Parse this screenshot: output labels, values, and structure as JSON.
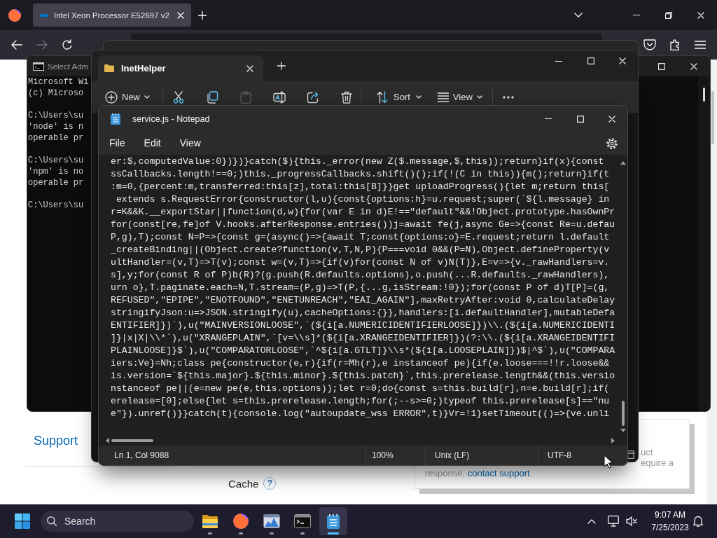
{
  "browser": {
    "tab": {
      "title": "Intel Xeon Processor E52697 v2",
      "selected": true
    },
    "nav_buttons": [
      {
        "disabled": false
      },
      {
        "disabled": true
      },
      {
        "disabled": false
      }
    ]
  },
  "web_page": {
    "sidebar_link": "Support",
    "field": {
      "label": "Cache",
      "help": "?"
    },
    "notice": {
      "lines": [
        "uct",
        "equire a"
      ],
      "text": "response,",
      "link": "contact support",
      "end": "."
    }
  },
  "command_prompt": {
    "title": "Select Adm",
    "blocks": [
      [
        "Microsoft Wi",
        "(c) Microso"
      ],
      [
        "C:\\Users\\su",
        "'node' is n",
        "operable pr"
      ],
      [
        "C:\\Users\\su",
        "'npm' is no",
        "operable pr"
      ],
      [
        "C:\\Users\\su"
      ]
    ]
  },
  "file_explorer": {
    "tab": "InetHelper",
    "toolbar": {
      "new": "New",
      "sort": "Sort",
      "view": "View",
      "actions": [
        {
          "disabled": false
        },
        {
          "disabled": false
        },
        {
          "disabled": true
        },
        {
          "disabled": false
        },
        {
          "disabled": false
        },
        {
          "disabled": false
        }
      ]
    }
  },
  "notepad": {
    "title": "service.js - Notepad",
    "menu": [
      "File",
      "Edit",
      "View"
    ],
    "lines": [
      "er:$,computedValue:0})})}catch($){this._error(new Z($.message,$,this));return}if(x){const",
      "ssCallbacks.length!==0;)this._progressCallbacks.shift()();if(!(C in this)){m();return}if(t",
      ":m=0,{percent:m,transferred:this[z],total:this[B]}}get uploadProgress(){let m;return this[",
      " extends s.RequestError{constructor(l,u){const{options:h}=u.request;super(`${l.message} in",
      "r=K&&K.__exportStar||function(d,w){for(var E in d)E!==\"default\"&&!Object.prototype.hasOwnPr",
      "for(const[re,fe]of V.hooks.afterResponse.entries())j=await fe(j,async Ge=>{const Re=u.defau",
      "P,g),T);const N=P=>{const g=(async()=>{await T;const{options:o}=E.request;return l.default",
      "_createBinding||(Object.create?function(v,T,N,P){P===void 0&&(P=N),Object.defineProperty(v",
      "ultHandler=(v,T)=>T(v);const w=(v,T)=>{if(v)for(const N of v)N(T)},E=v=>{v._rawHandlers=v.",
      "s],y;for(const R of P)b(R)?(g.push(R.defaults.options),o.push(...R.defaults._rawHandlers),",
      "urn o},T.paginate.each=N,T.stream=(P,g)=>T(P,{...g,isStream:!0});for(const P of d)T[P]=(g,",
      "REFUSED\",\"EPIPE\",\"ENOTFOUND\",\"ENETUNREACH\",\"EAI_AGAIN\"],maxRetryAfter:void 0,calculateDelay",
      "stringifyJson:u=>JSON.stringify(u),cacheOptions:{}},handlers:[i.defaultHandler],mutableDefa",
      "ENTIFIER]})`),u(\"MAINVERSIONLOOSE\",`(${i[a.NUMERICIDENTIFIERLOOSE]})\\\\.(${i[a.NUMERICIDENTI",
      "]}|x|X|\\\\*`),u(\"XRANGEPLAIN\",`[v=\\\\s]*(${i[a.XRANGEIDENTIFIER]})(?:\\\\.(${i[a.XRANGEIDENTIFI",
      "PLAINLOOSE]}$`),u(\"COMPARATORLOOSE\",`^${i[a.GTLT]}\\\\s*(${i[a.LOOSEPLAIN]})$|^$`),u(\"COMPARA",
      "iers:Ve}=Nh;class pe{constructor(e,r){if(r=Mh(r),e instanceof pe){if(e.loose===!!r.loose&&",
      "is.version=`${this.major}.${this.minor}.${this.patch}`,this.prerelease.length&&(this.versio",
      "nstanceof pe||(e=new pe(e,this.options));let r=0;do{const s=this.build[r],n=e.build[r];if(",
      "erelease=[0];else{let s=this.prerelease.length;for(;--s>=0;)typeof this.prerelease[s]==\"nu",
      "e\"}).unref()}}catch(t){console.log(\"autoupdate_wss ERROR\",t)}Vr=!1}setTimeout(()=>{ve.unli"
    ],
    "status_bar": {
      "position": "Ln 1, Col 9088",
      "zoom": "100%",
      "line_ending": "Unix (LF)",
      "encoding": "UTF-8"
    }
  },
  "taskbar": {
    "search": {
      "placeholder": "Search"
    },
    "apps": [
      {
        "running": true,
        "selected": false
      },
      {
        "running": true,
        "selected": false
      },
      {
        "running": true,
        "selected": false
      },
      {
        "running": true,
        "selected": false
      },
      {
        "running": true,
        "selected": true
      }
    ],
    "clock": {
      "time": "9:07 AM",
      "date": "7/25/2023"
    }
  }
}
